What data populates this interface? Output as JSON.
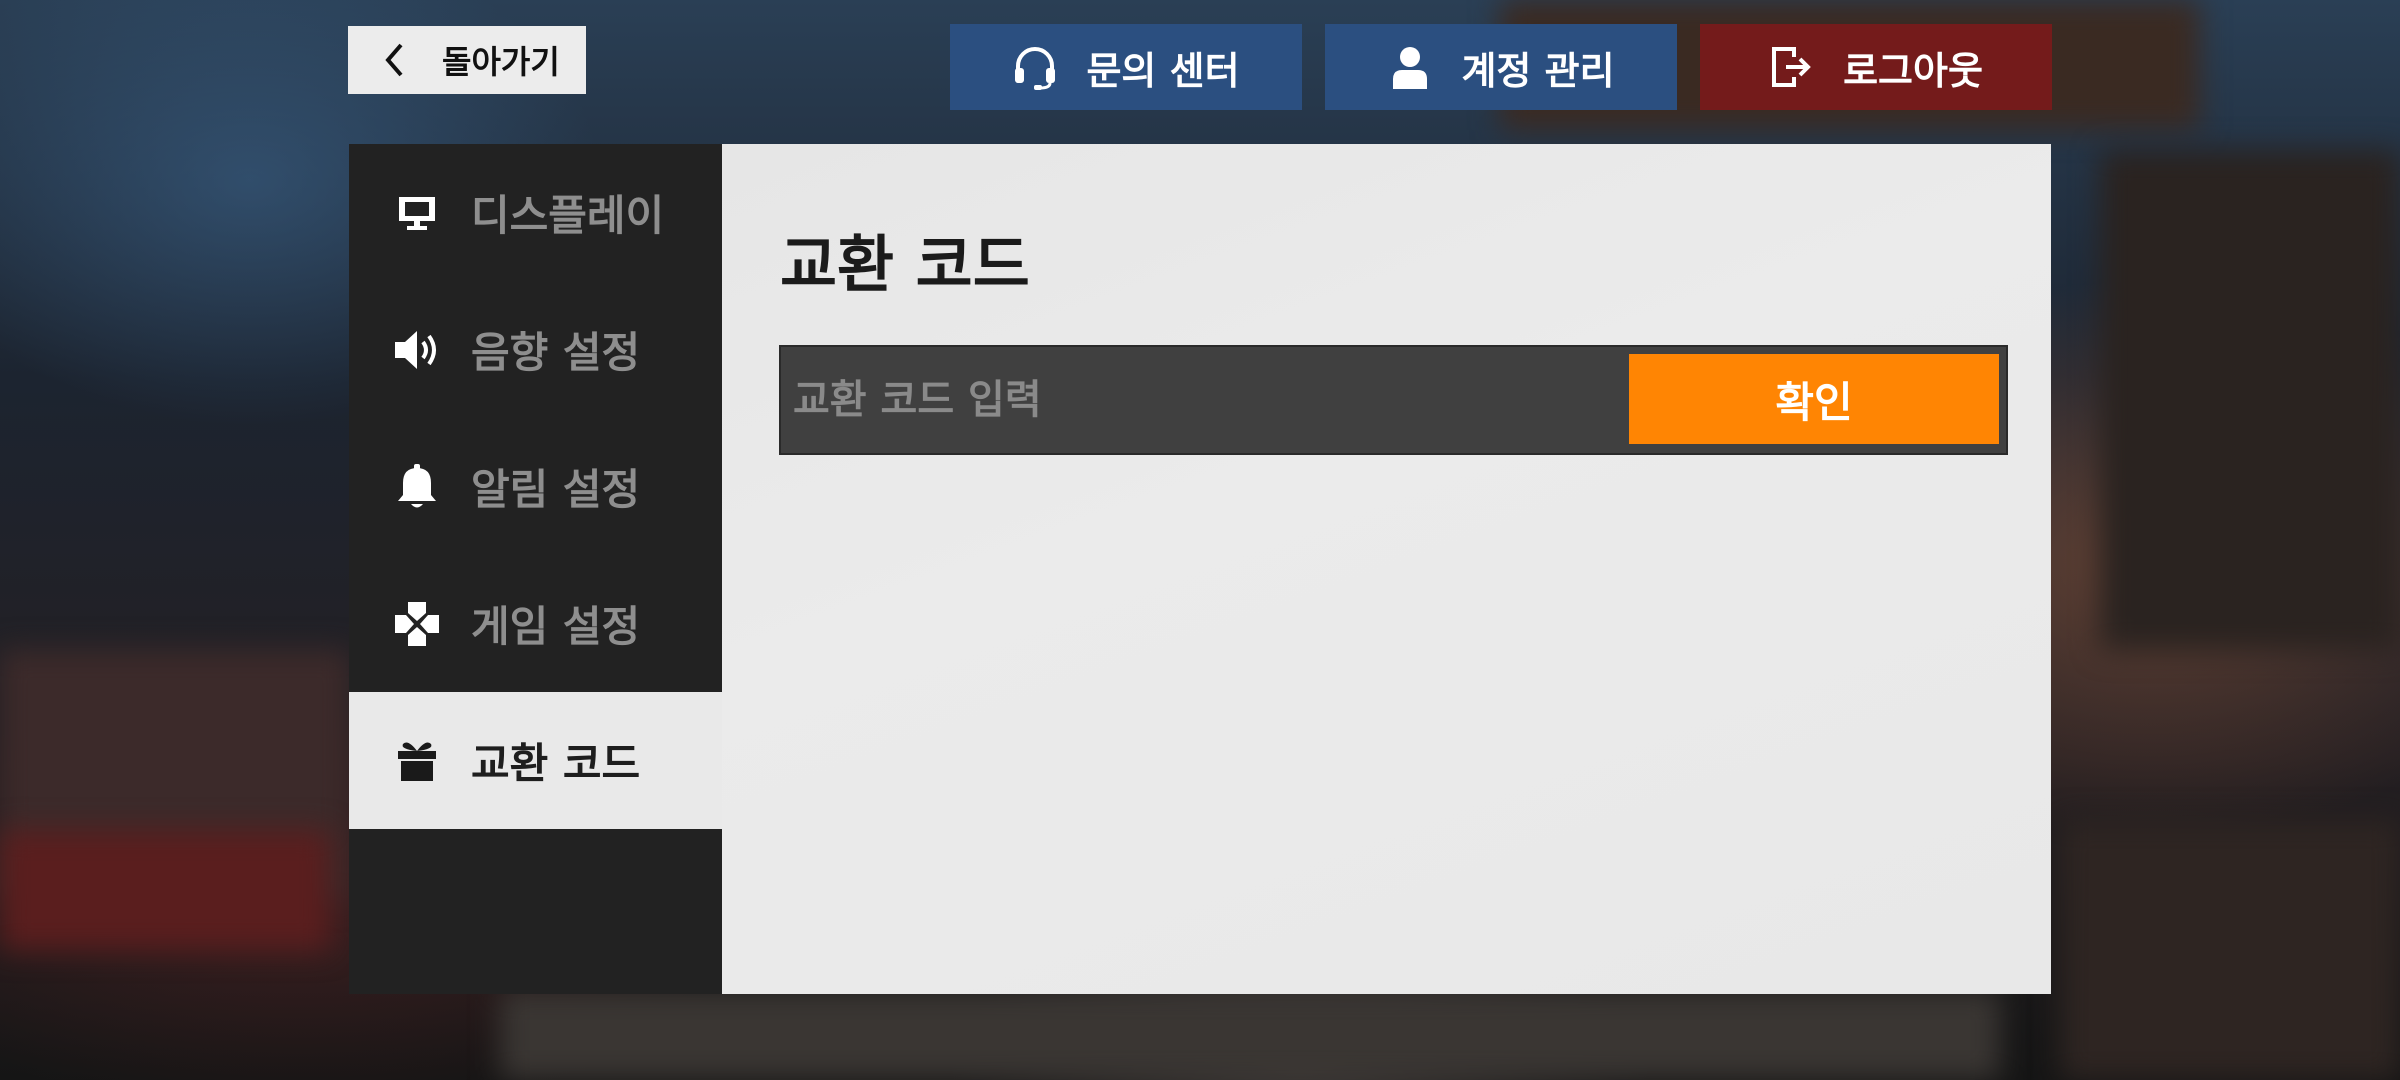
{
  "back": {
    "label": "돌아가기",
    "icon": "chevron-left-icon"
  },
  "header": {
    "support_label": "문의 센터",
    "account_label": "계정 관리",
    "logout_label": "로그아웃"
  },
  "sidebar": {
    "items": [
      {
        "label": "디스플레이",
        "icon": "monitor-icon",
        "active": false
      },
      {
        "label": "음향 설정",
        "icon": "speaker-icon",
        "active": false
      },
      {
        "label": "알림 설정",
        "icon": "bell-icon",
        "active": false
      },
      {
        "label": "게임 설정",
        "icon": "gamepad-icon",
        "active": false
      },
      {
        "label": "교환 코드",
        "icon": "gift-icon",
        "active": true
      }
    ]
  },
  "main": {
    "title": "교환 코드",
    "code_input": {
      "value": "",
      "placeholder": "교환 코드 입력"
    },
    "confirm_label": "확인"
  },
  "colors": {
    "blue_button": "#2b4f80",
    "logout_button": "#741b1b",
    "confirm_button": "#ff8503",
    "sidebar_bg": "#222222",
    "panel_bg": "#e8e8e8"
  }
}
